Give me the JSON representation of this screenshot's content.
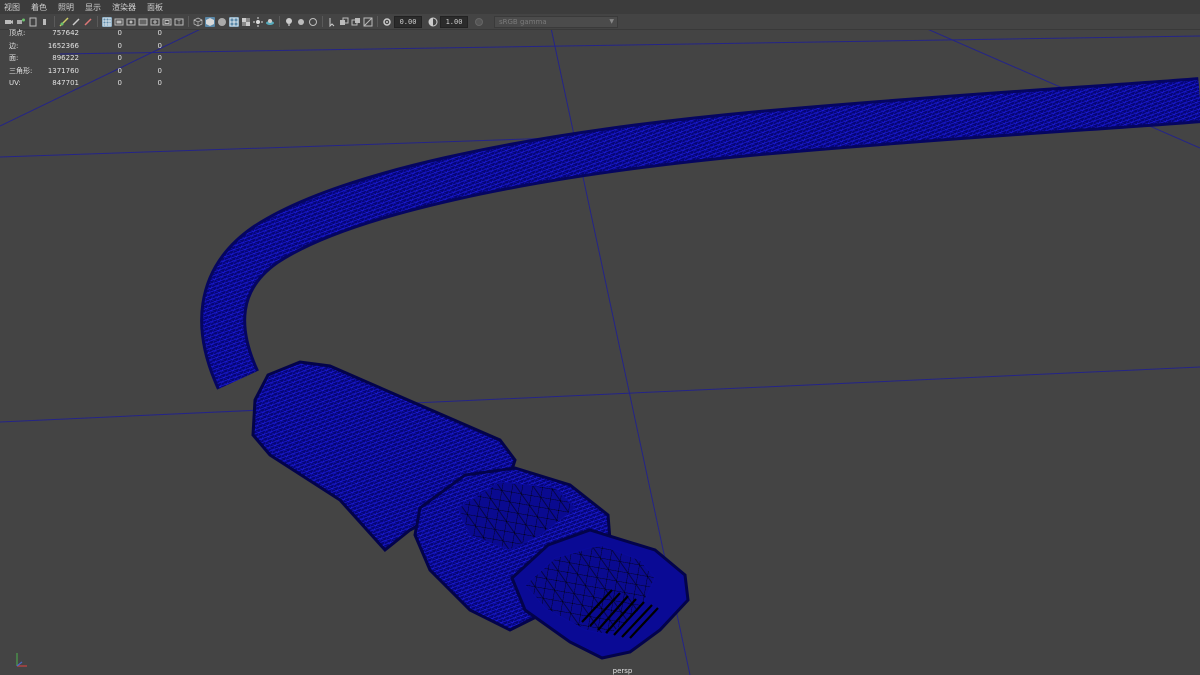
{
  "menu": [
    "视图",
    "着色",
    "照明",
    "显示",
    "渲染器",
    "面板"
  ],
  "toolbar": {
    "exposure": "0.00",
    "gamma": "1.00",
    "color_space": "sRGB gamma"
  },
  "hud": {
    "rows": [
      {
        "label": "顶点:",
        "v1": "757642",
        "v2": "0",
        "v3": "0"
      },
      {
        "label": "边:",
        "v1": "1652366",
        "v2": "0",
        "v3": "0"
      },
      {
        "label": "面:",
        "v1": "896222",
        "v2": "0",
        "v3": "0"
      },
      {
        "label": "三角形:",
        "v1": "1371760",
        "v2": "0",
        "v3": "0"
      },
      {
        "label": "UV:",
        "v1": "847701",
        "v2": "0",
        "v3": "0"
      }
    ]
  },
  "viewport": {
    "camera": "persp",
    "background_color": "#444444",
    "wire_color": "#0d0d8c",
    "grid_color": "#1e1e7a"
  }
}
